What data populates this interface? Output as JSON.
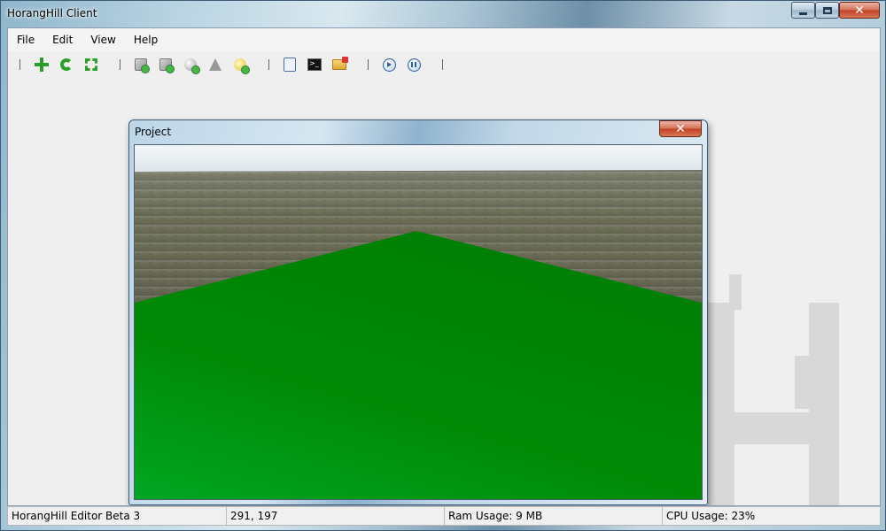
{
  "window": {
    "title": "HorangHill Client"
  },
  "menu": {
    "items": [
      "File",
      "Edit",
      "View",
      "Help"
    ]
  },
  "toolbar": {
    "icons": [
      "move-icon",
      "rotate-icon",
      "scale-icon",
      "add-part-icon",
      "add-cylinder-icon",
      "add-sphere-icon",
      "add-cone-icon",
      "add-light-icon",
      "script-icon",
      "console-icon",
      "open-folder-icon",
      "play-icon",
      "pause-icon"
    ]
  },
  "child_window": {
    "title": "Project"
  },
  "viewport": {
    "sky_color": "#e6ecef",
    "terrain_color": "#6a6f55",
    "baseplate_color": "#008a06"
  },
  "status": {
    "app_label": "HorangHill Editor Beta 3",
    "coords": "291, 197",
    "ram": "Ram Usage: 9 MB",
    "cpu": "CPU Usage: 23%"
  }
}
